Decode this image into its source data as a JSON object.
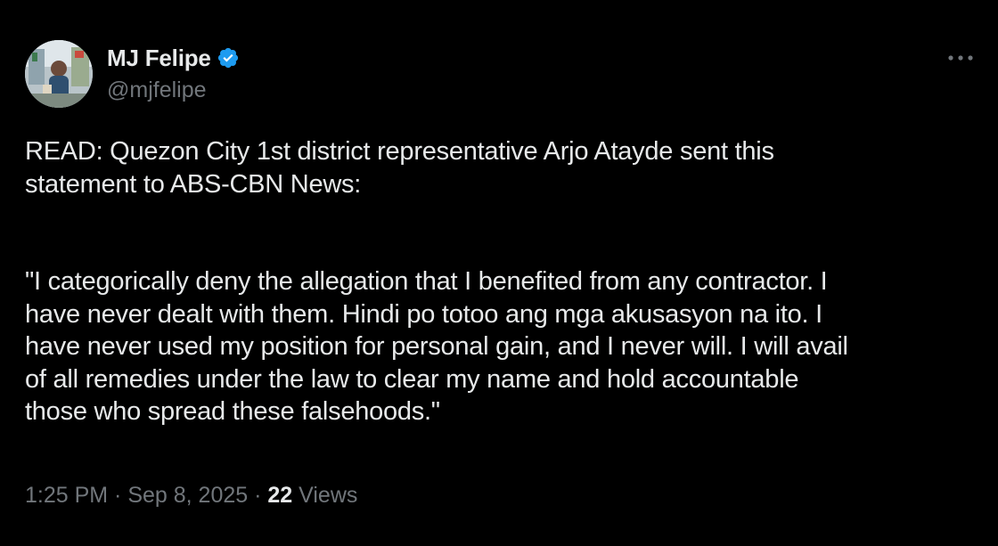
{
  "author": {
    "display_name": "MJ Felipe",
    "handle": "@mjfelipe",
    "verified": true,
    "verified_color": "#1d9bf0"
  },
  "menu": {
    "icon": "more-horizontal-icon"
  },
  "tweet": {
    "paragraphs": [
      "READ: Quezon City 1st district representative Arjo Atayde sent this\nstatement to ABS-CBN News:",
      "\"I categorically deny the allegation that I benefited from any contractor. I\nhave never dealt with them. Hindi po totoo ang mga akusasyon na ito. I\nhave never used my position for personal gain, and I never will. I will avail\nof all remedies under the law to clear my name and hold accountable\nthose who spread these falsehoods.\""
    ]
  },
  "meta": {
    "time": "1:25 PM",
    "separator": " · ",
    "date": "Sep 8, 2025",
    "views_count": "22",
    "views_label": " Views"
  },
  "colors": {
    "background": "#000000",
    "primary_text": "#e7e9ea",
    "secondary_text": "#71767b"
  }
}
